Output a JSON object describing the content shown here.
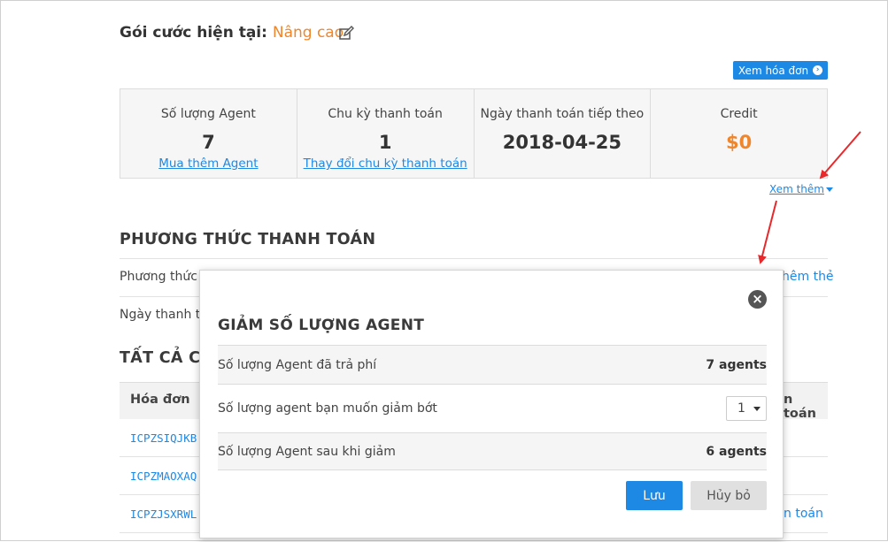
{
  "plan": {
    "label": "Gói cước hiện tại:",
    "value": "Nâng cao"
  },
  "toolbar": {
    "view_invoice": "Xem hóa đơn"
  },
  "stats": [
    {
      "label": "Số lượng Agent",
      "value": "7",
      "link": "Mua thêm Agent"
    },
    {
      "label": "Chu kỳ thanh toán",
      "value": "1",
      "link": "Thay đổi chu kỳ thanh toán"
    },
    {
      "label": "Ngày thanh toán tiếp theo",
      "value": "2018-04-25",
      "link": ""
    },
    {
      "label": "Credit",
      "value": "$0",
      "link": ""
    }
  ],
  "see_more": "Xem thêm",
  "payment": {
    "title": "PHƯƠNG THỨC THANH TOÁN",
    "method_label": "Phương thức t",
    "add_card_link": "hêm thẻ",
    "date_label": "Ngày thanh tơ"
  },
  "invoices": {
    "title": "TẤT CẢ CA",
    "col_invoice": "Hóa đơn",
    "col_payment": "n toán",
    "rows": [
      "ICPZSIQJKB",
      "ICPZMAOXAQ",
      "ICPZJSXRWL"
    ],
    "row3_action": "n toán"
  },
  "modal": {
    "title": "GIẢM SỐ LƯỢNG AGENT",
    "paid_label": "Số lượng Agent đã trả phí",
    "paid_value": "7 agents",
    "reduce_label": "Số lượng agent bạn muốn giảm bớt",
    "reduce_value": "1",
    "after_label": "Số lượng Agent sau khi giảm",
    "after_value": "6 agents",
    "save": "Lưu",
    "cancel": "Hủy bỏ",
    "close": "×"
  },
  "colors": {
    "accent": "#1e88e5",
    "orange": "#f0862b",
    "arrow": "#e8282b"
  }
}
